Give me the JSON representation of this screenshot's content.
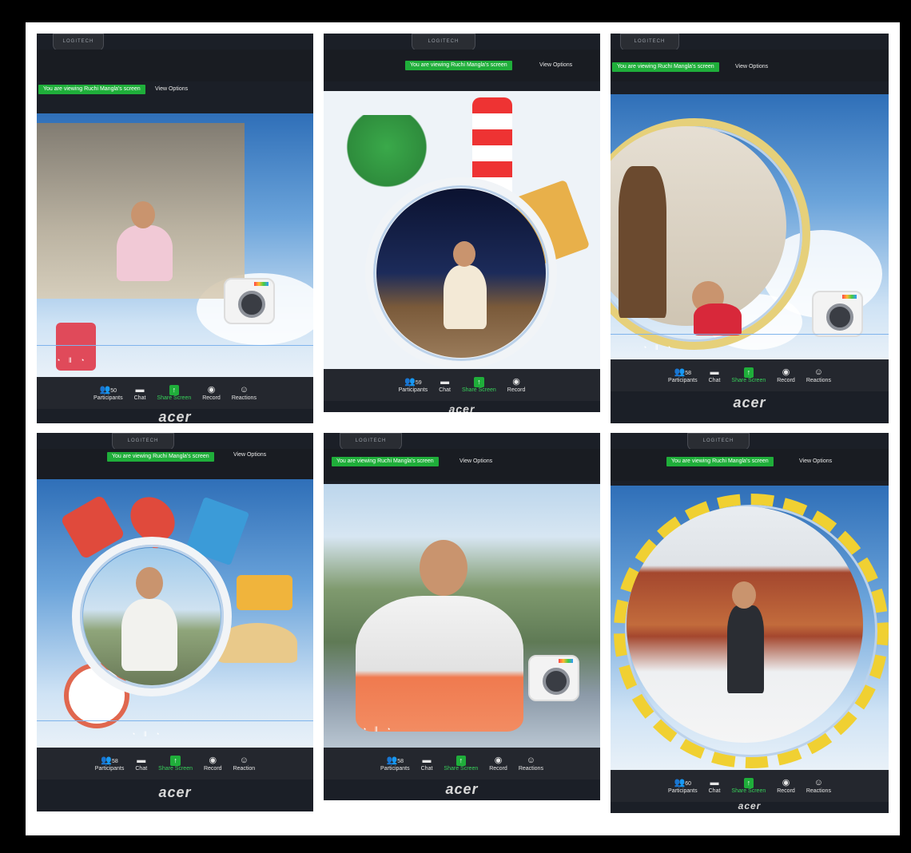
{
  "screens": [
    {
      "banner": "You are viewing Ruchi Mangla's screen",
      "view_options": "View Options",
      "toolbar": {
        "participants_count": "50",
        "participants_label": "Participants",
        "chat_label": "Chat",
        "share_label": "Share Screen",
        "record_label": "Record",
        "reactions_label": "Reactions"
      },
      "brand": "acer"
    },
    {
      "banner": "You are viewing Ruchi Mangla's screen",
      "view_options": "View Options",
      "toolbar": {
        "participants_count": "59",
        "participants_label": "Participants",
        "chat_label": "Chat",
        "share_label": "Share Screen",
        "record_label": "Record"
      },
      "brand": "acer"
    },
    {
      "banner": "You are viewing Ruchi Mangla's screen",
      "view_options": "View Options",
      "toolbar": {
        "participants_count": "58",
        "participants_label": "Participants",
        "chat_label": "Chat",
        "share_label": "Share Screen",
        "record_label": "Record",
        "reactions_label": "Reactions"
      },
      "brand": "acer"
    },
    {
      "banner": "You are viewing Ruchi Mangla's screen",
      "view_options": "View Options",
      "toolbar": {
        "participants_count": "58",
        "participants_label": "Participants",
        "chat_label": "Chat",
        "share_label": "Share Screen",
        "record_label": "Record",
        "reactions_label": "Reaction"
      },
      "brand": "acer"
    },
    {
      "banner": "You are viewing Ruchi Mangla's screen",
      "view_options": "View Options",
      "toolbar": {
        "participants_count": "58",
        "participants_label": "Participants",
        "chat_label": "Chat",
        "share_label": "Share Screen",
        "record_label": "Record",
        "reactions_label": "Reactions"
      },
      "brand": "acer"
    },
    {
      "banner": "You are viewing Ruchi Mangla's screen",
      "view_options": "View Options",
      "toolbar": {
        "participants_count": "60",
        "participants_label": "Participants",
        "chat_label": "Chat",
        "share_label": "Share Screen",
        "record_label": "Record",
        "reactions_label": "Reactions"
      },
      "brand": "acer"
    }
  ],
  "icons": {
    "participants": "people-icon",
    "chat": "chat-bubble-icon",
    "share": "share-screen-icon",
    "record": "record-icon",
    "reactions": "emoji-icon",
    "caret": "caret-up-icon"
  },
  "colors": {
    "banner_green": "#1fae3a",
    "toolbar_bg": "#24272e",
    "sky_blue": "#6aa3da"
  }
}
